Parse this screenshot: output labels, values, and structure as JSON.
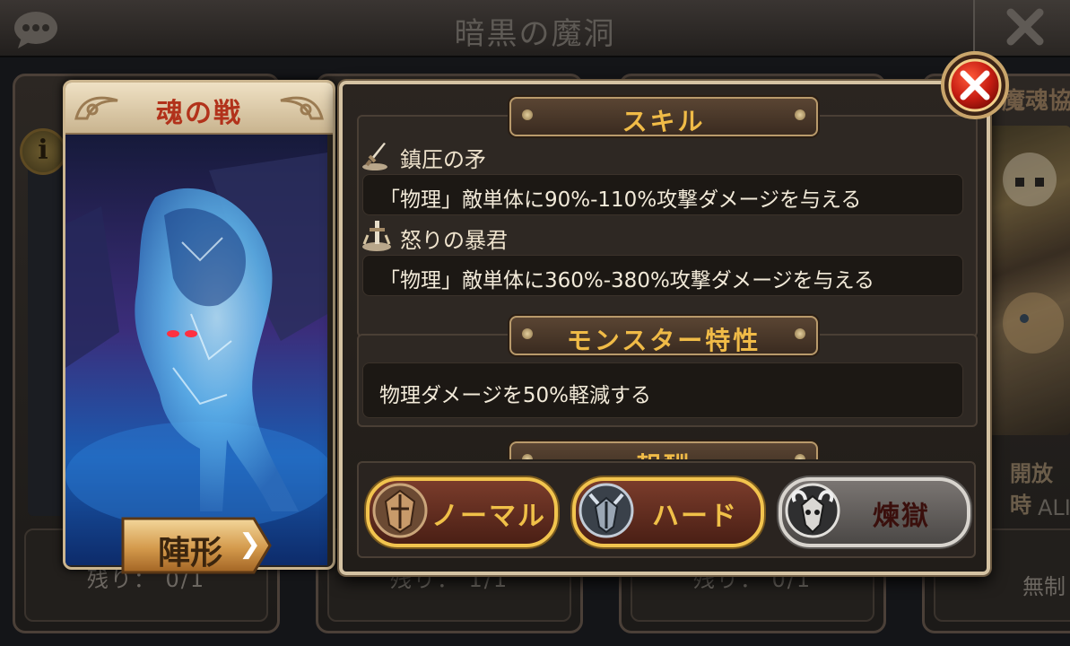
{
  "header": {
    "title": "暗黒の魔洞"
  },
  "left_card": {
    "title": "魂の戦",
    "formation_label": "陣形",
    "formation_arrow": "❯"
  },
  "background_cards": {
    "remaining": [
      "残り： 0/1",
      "残り： 1/1",
      "残り： 0/1"
    ],
    "right_title": "魔魂協",
    "right_open_label": "開放時",
    "right_open_value": "ALI",
    "right_remaining": "無制"
  },
  "popup": {
    "skills_header": "スキル",
    "skills": [
      {
        "name": "鎮圧の矛",
        "description": "「物理」敵単体に90%-110%攻撃ダメージを与える",
        "icon": "sword-icon"
      },
      {
        "name": "怒りの暴君",
        "description": "「物理」敵単体に360%-380%攻撃ダメージを与える",
        "icon": "sword-stand-icon"
      }
    ],
    "trait_header": "モンスター特性",
    "trait_description": "物理ダメージを50%軽減する",
    "reward_header_partial": "報酬"
  },
  "difficulty": {
    "buttons": [
      {
        "label": "ノーマル",
        "icon": "bronze-helmet-icon",
        "state": "enabled"
      },
      {
        "label": "ハード",
        "icon": "silver-helmet-icon",
        "state": "enabled"
      },
      {
        "label": "煉獄",
        "icon": "ram-skull-icon",
        "state": "locked"
      }
    ]
  },
  "colors": {
    "accent_gold": "#f0bb47",
    "card_title_red": "#b2321b",
    "close_red": "#c61d12"
  }
}
